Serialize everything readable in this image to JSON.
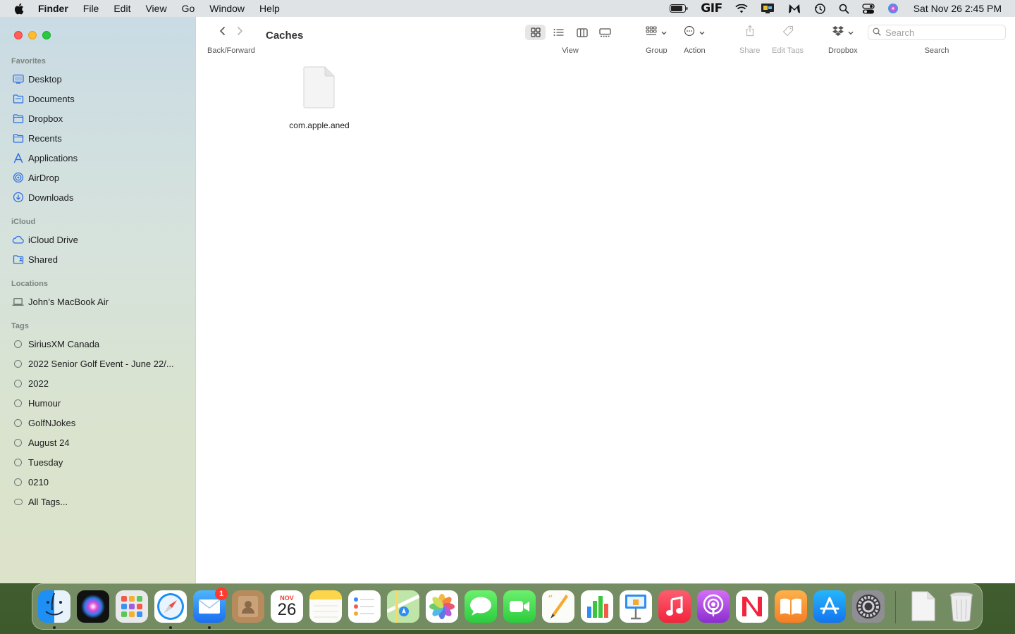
{
  "menubar": {
    "app_name": "Finder",
    "items": [
      "File",
      "Edit",
      "View",
      "Go",
      "Window",
      "Help"
    ],
    "gif_label": "GIF",
    "clock": "Sat Nov 26  2:45 PM"
  },
  "window": {
    "title": "Caches"
  },
  "sidebar": {
    "favorites_header": "Favorites",
    "favorites": [
      {
        "label": "Desktop",
        "icon": "desktop-icon"
      },
      {
        "label": "Documents",
        "icon": "document-icon"
      },
      {
        "label": "Dropbox",
        "icon": "folder-icon"
      },
      {
        "label": "Recents",
        "icon": "folder-icon"
      },
      {
        "label": "Applications",
        "icon": "applications-icon"
      },
      {
        "label": "AirDrop",
        "icon": "airdrop-icon"
      },
      {
        "label": "Downloads",
        "icon": "downloads-icon"
      }
    ],
    "icloud_header": "iCloud",
    "icloud": [
      {
        "label": "iCloud Drive",
        "icon": "cloud-icon"
      },
      {
        "label": "Shared",
        "icon": "shared-folder-icon"
      }
    ],
    "locations_header": "Locations",
    "locations": [
      {
        "label": "John’s MacBook Air",
        "icon": "laptop-icon"
      }
    ],
    "tags_header": "Tags",
    "tags": [
      "SiriusXM Canada",
      "2022 Senior Golf Event - June 22/...",
      "2022",
      "Humour",
      "GolfNJokes",
      "August 24",
      "Tuesday",
      "0210",
      "All Tags..."
    ]
  },
  "toolbar": {
    "back_forward_label": "Back/Forward",
    "view_label": "View",
    "group_label": "Group",
    "action_label": "Action",
    "share_label": "Share",
    "edit_tags_label": "Edit Tags",
    "dropbox_label": "Dropbox",
    "search_label": "Search",
    "search_placeholder": "Search"
  },
  "content": {
    "files": [
      {
        "name": "com.apple.aned",
        "icon": "document-file-icon"
      }
    ]
  },
  "dock": {
    "mail_badge": "1",
    "calendar_month": "NOV",
    "calendar_day": "26",
    "apps": [
      "Finder",
      "Siri",
      "Launchpad",
      "Safari",
      "Mail",
      "Contacts",
      "Calendar",
      "Notes",
      "Reminders",
      "Maps",
      "Photos",
      "Messages",
      "FaceTime",
      "Pages",
      "Numbers",
      "Keynote",
      "Music",
      "Podcasts",
      "News",
      "Books",
      "App Store",
      "System Preferences",
      "Documents",
      "Trash"
    ]
  },
  "colors": {
    "accent": "#1e6ff3",
    "sidebar_icon": "#2f6fe4",
    "close": "#fe5f57",
    "minimize": "#febc2e",
    "maximize": "#28c840"
  }
}
